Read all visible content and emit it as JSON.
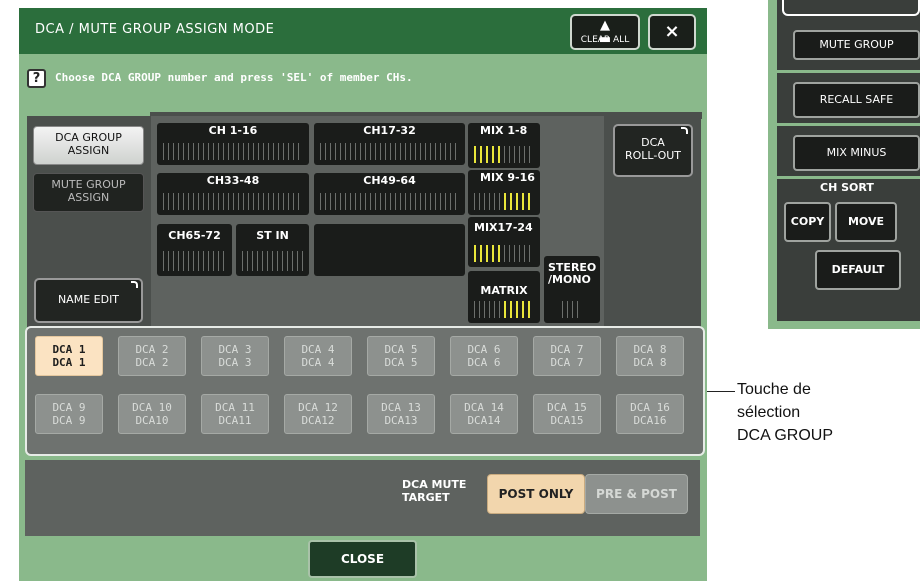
{
  "dialog": {
    "title": "DCA / MUTE GROUP ASSIGN MODE",
    "clear_all_label": "CLEAR ALL",
    "close_x": "×",
    "help_text": "Choose DCA GROUP number and press 'SEL' of member CHs.",
    "help_icon": "?",
    "close_label": "CLOSE"
  },
  "modes": {
    "dca_group_assign": "DCA GROUP\nASSIGN",
    "mute_group_assign": "MUTE GROUP\nASSIGN",
    "name_edit": "NAME EDIT",
    "dca_rollout": "DCA\nROLL-OUT"
  },
  "channel_blocks": {
    "ch1_16": "CH 1-16",
    "ch17_32": "CH17-32",
    "ch33_48": "CH33-48",
    "ch49_64": "CH49-64",
    "ch65_72": "CH65-72",
    "st_in": "ST IN",
    "mix1_8": "MIX 1-8",
    "mix9_16": "MIX 9-16",
    "mix17_24": "MIX17-24",
    "matrix": "MATRIX",
    "stereo_mono": "STEREO\n/MONO"
  },
  "dca_groups": [
    {
      "number": "DCA 1",
      "name": "DCA 1",
      "selected": true
    },
    {
      "number": "DCA 2",
      "name": "DCA 2",
      "selected": false
    },
    {
      "number": "DCA 3",
      "name": "DCA 3",
      "selected": false
    },
    {
      "number": "DCA 4",
      "name": "DCA 4",
      "selected": false
    },
    {
      "number": "DCA 5",
      "name": "DCA 5",
      "selected": false
    },
    {
      "number": "DCA 6",
      "name": "DCA 6",
      "selected": false
    },
    {
      "number": "DCA 7",
      "name": "DCA 7",
      "selected": false
    },
    {
      "number": "DCA 8",
      "name": "DCA 8",
      "selected": false
    },
    {
      "number": "DCA 9",
      "name": "DCA 9",
      "selected": false
    },
    {
      "number": "DCA 10",
      "name": "DCA10",
      "selected": false
    },
    {
      "number": "DCA 11",
      "name": "DCA11",
      "selected": false
    },
    {
      "number": "DCA 12",
      "name": "DCA12",
      "selected": false
    },
    {
      "number": "DCA 13",
      "name": "DCA13",
      "selected": false
    },
    {
      "number": "DCA 14",
      "name": "DCA14",
      "selected": false
    },
    {
      "number": "DCA 15",
      "name": "DCA15",
      "selected": false
    },
    {
      "number": "DCA 16",
      "name": "DCA16",
      "selected": false
    }
  ],
  "mute_target": {
    "label": "DCA MUTE\nTARGET",
    "post_only": "POST ONLY",
    "pre_post": "PRE & POST",
    "selected": "POST ONLY"
  },
  "callout": {
    "line1": "Touche de",
    "line2": "sélection",
    "line3": "DCA GROUP"
  },
  "side_panel": {
    "mute_group": "MUTE GROUP",
    "recall_safe": "RECALL SAFE",
    "mix_minus": "MIX MINUS",
    "ch_sort": "CH SORT",
    "copy": "COPY",
    "move": "MOVE",
    "default": "DEFAULT"
  },
  "colors": {
    "title_bar": "#2b6e3c",
    "dialog_bg": "#8ab98b",
    "selected_dca": "#fbe3c2",
    "fader_active": "#e9e63a"
  }
}
